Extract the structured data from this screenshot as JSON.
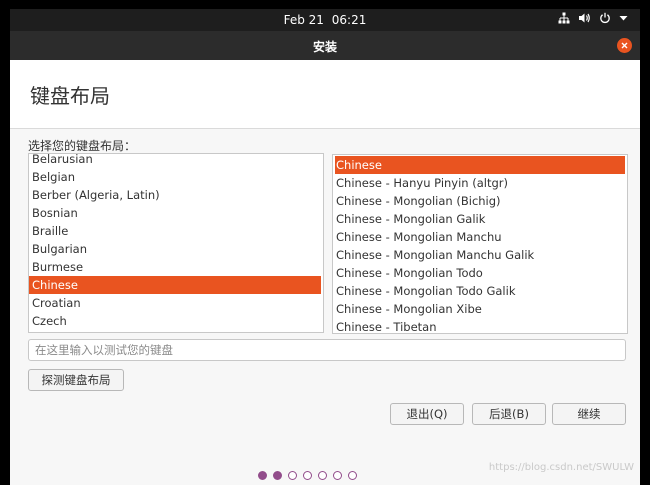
{
  "topbar": {
    "date": "Feb 21",
    "time": "06:21",
    "icons": [
      "network-icon",
      "volume-icon",
      "power-icon",
      "dropdown-arrow-icon"
    ]
  },
  "window": {
    "title": "安装",
    "close_icon": "close-icon"
  },
  "page": {
    "title": "键盘布局",
    "prompt": "选择您的键盘布局："
  },
  "layouts": {
    "items": [
      "Belarusian",
      "Belgian",
      "Berber (Algeria, Latin)",
      "Bosnian",
      "Braille",
      "Bulgarian",
      "Burmese",
      "Chinese",
      "Croatian",
      "Czech"
    ],
    "selected": "Chinese"
  },
  "variants": {
    "items": [
      "Chinese",
      "Chinese - Hanyu Pinyin (altgr)",
      "Chinese - Mongolian (Bichig)",
      "Chinese - Mongolian Galik",
      "Chinese - Mongolian Manchu",
      "Chinese - Mongolian Manchu Galik",
      "Chinese - Mongolian Todo",
      "Chinese - Mongolian Todo Galik",
      "Chinese - Mongolian Xibe",
      "Chinese - Tibetan"
    ],
    "selected": "Chinese"
  },
  "test_input": {
    "placeholder": "在这里输入以测试您的键盘",
    "value": ""
  },
  "buttons": {
    "detect": "探测键盘布局",
    "quit": "退出(Q)",
    "back": "后退(B)",
    "continue": "继续"
  },
  "progress": {
    "total_steps": 7,
    "completed_steps": 2
  },
  "watermark": "https://blog.csdn.net/SWULW",
  "colors": {
    "accent": "#e95420",
    "progress_dot": "#924d8b",
    "topbar": "#1e1e1e",
    "titlebar": "#2c2c2c"
  }
}
